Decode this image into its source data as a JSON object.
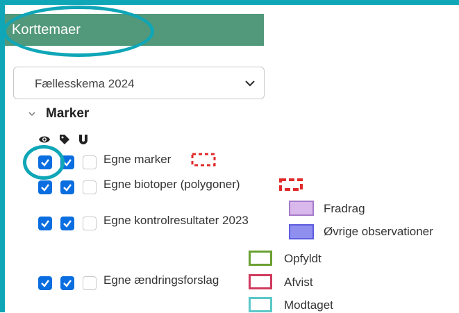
{
  "panel": {
    "title": "Korttemaer"
  },
  "season_select": {
    "value": "Fællesskema 2024"
  },
  "section": {
    "title": "Marker"
  },
  "column_icons": [
    "eye-icon",
    "tag-icon",
    "magnet-icon"
  ],
  "layers": [
    {
      "label": "Egne marker",
      "visible": true,
      "labels": true,
      "snap": false
    },
    {
      "label": "Egne biotoper (polygoner)",
      "visible": true,
      "labels": true,
      "snap": false
    },
    {
      "label": "Egne kontrolresultater 2023",
      "visible": true,
      "labels": true,
      "snap": false,
      "legend": [
        {
          "label": "Fradrag",
          "fill": "#d9b8ec",
          "stroke": "#a67ac9"
        },
        {
          "label": "Øvrige observationer",
          "fill": "#8f8ff0",
          "stroke": "#5d5de0"
        }
      ]
    },
    {
      "label": "Egne ændringsforslag",
      "visible": true,
      "labels": true,
      "snap": false,
      "legend": [
        {
          "label": "Opfyldt",
          "stroke": "#6aa031"
        },
        {
          "label": "Afvist",
          "stroke": "#d03b5e"
        },
        {
          "label": "Modtaget",
          "stroke": "#5bc7c7"
        }
      ]
    }
  ],
  "colors": {
    "accent": "#0fa6b7",
    "header": "#52987a",
    "checkbox": "#0b6ee0",
    "red_outline": "#e02b2b"
  }
}
